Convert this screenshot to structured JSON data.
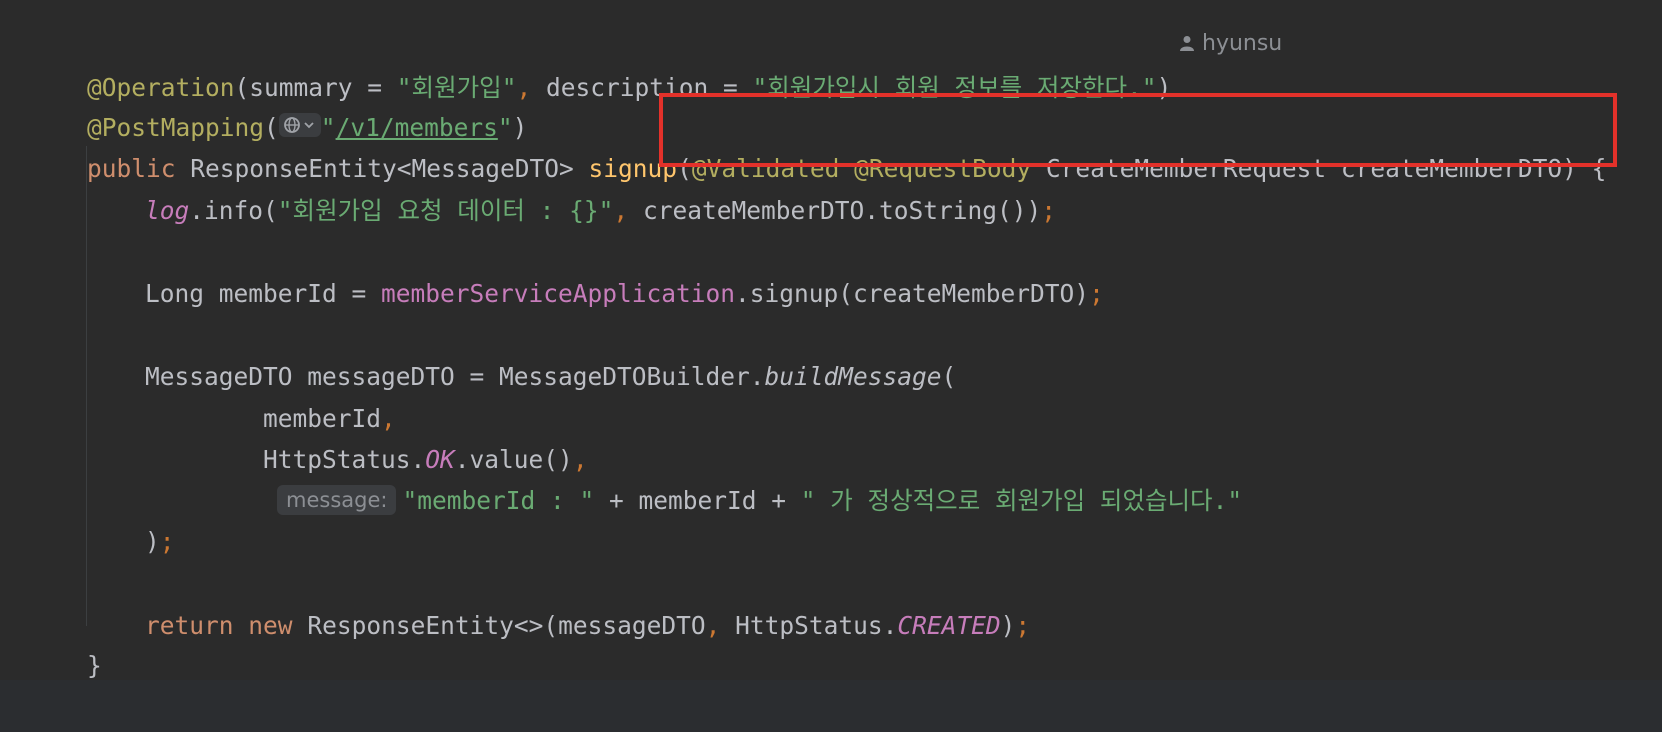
{
  "code": {
    "l1": {
      "ann": "@Operation",
      "open": "(summary = ",
      "summary_str": "\"회원가입\"",
      "comma": ",",
      "mid": " description = ",
      "desc_str": "\"회원가입시 회원 정보를 저장한다.\"",
      "close": ")"
    },
    "author": "hyunsu",
    "l2": {
      "ann": "@PostMapping",
      "open": "(",
      "q1": "\"",
      "path": "/v1/members",
      "q2": "\"",
      "close": ")"
    },
    "l3": {
      "kw": "public",
      "type": " ResponseEntity<MessageDTO> ",
      "method": "signup",
      "open": "(",
      "ann1": "@Validated",
      "sp1": " ",
      "ann2": "@RequestBody",
      "params": " CreateMemberRequest createMemberDTO) {"
    },
    "l4": {
      "log": "log",
      "call": ".info(",
      "str": "\"회원가입 요청 데이터 : {}\"",
      "comma": ",",
      "rest": " createMemberDTO.toString())",
      "semi": ";"
    },
    "l6": {
      "pre": "Long memberId = ",
      "field": "memberServiceApplication",
      "post": ".signup(createMemberDTO)",
      "semi": ";"
    },
    "l8": {
      "pre": "MessageDTO messageDTO = MessageDTOBuilder.",
      "method": "buildMessage",
      "post": "("
    },
    "l9": {
      "text": "memberId",
      "comma": ","
    },
    "l10": {
      "pre": "HttpStatus.",
      "constant": "OK",
      "post": ".value()",
      "comma": ","
    },
    "l11": {
      "hint": "message:",
      "str1": "\"memberId : \"",
      "mid": " + memberId + ",
      "str2": "\" 가 정상적으로 회원가입 되었습니다.\""
    },
    "l12": {
      "close": ")",
      "semi": ";"
    },
    "l14": {
      "kw1": "return",
      "sp": " ",
      "kw2": "new",
      "pre": " ResponseEntity<>(messageDTO",
      "comma": ",",
      "mid": " HttpStatus.",
      "constant": "CREATED",
      "close": ")",
      "semi": ";"
    },
    "l15": {
      "brace": "}"
    }
  },
  "colors": {
    "annotation": "#b3ae60",
    "keyword": "#cf8e6d",
    "string": "#6aab73",
    "method_decl": "#ffc66d",
    "field": "#c77dbb",
    "highlight_box": "#e3312a"
  },
  "icons": {
    "author": "user-icon",
    "url": "globe-icon"
  }
}
